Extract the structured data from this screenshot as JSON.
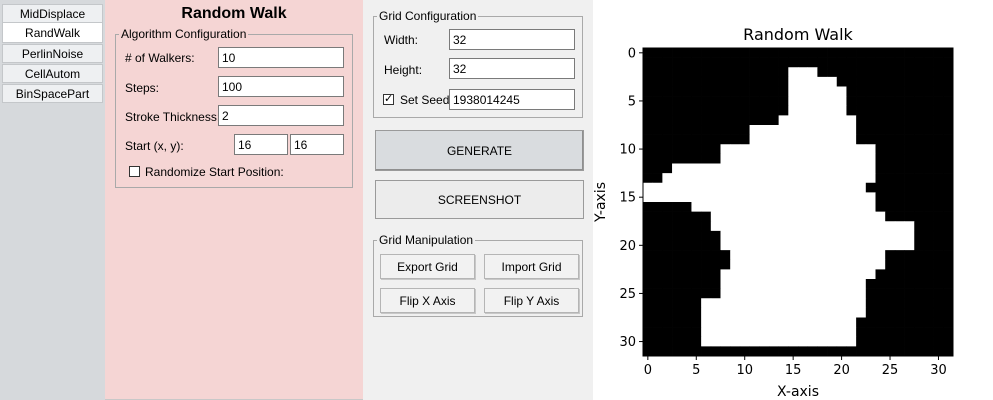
{
  "sidebar": {
    "tabs": [
      {
        "label": "MidDisplace",
        "active": false
      },
      {
        "label": "RandWalk",
        "active": true
      },
      {
        "label": "PerlinNoise",
        "active": false
      },
      {
        "label": "CellAutom",
        "active": false
      },
      {
        "label": "BinSpacePart",
        "active": false
      }
    ]
  },
  "algorithm": {
    "title": "Random Walk",
    "group_label": "Algorithm Configuration",
    "walkers_label": "# of Walkers:",
    "walkers_value": "10",
    "steps_label": "Steps:",
    "steps_value": "100",
    "stroke_label": "Stroke Thickness:",
    "stroke_value": "2",
    "start_label": "Start (x, y):",
    "start_x": "16",
    "start_y": "16",
    "randomize_label": "Randomize Start Position:",
    "randomize_checked": false
  },
  "grid_config": {
    "group_label": "Grid Configuration",
    "width_label": "Width:",
    "width_value": "32",
    "height_label": "Height:",
    "height_value": "32",
    "seed_label": "Set Seed",
    "seed_checked": true,
    "seed_value": "1938014245"
  },
  "actions": {
    "generate_label": "GENERATE",
    "screenshot_label": "SCREENSHOT"
  },
  "grid_manipulation": {
    "group_label": "Grid Manipulation",
    "export_label": "Export Grid",
    "import_label": "Import Grid",
    "flip_x_label": "Flip X Axis",
    "flip_y_label": "Flip Y Axis"
  },
  "chart_data": {
    "type": "heatmap",
    "title": "Random Walk",
    "xlabel": "X-axis",
    "ylabel": "Y-axis",
    "x_ticks": [
      0,
      5,
      10,
      15,
      20,
      25,
      30
    ],
    "y_ticks": [
      0,
      5,
      10,
      15,
      20,
      25,
      30
    ],
    "xlim": [
      -0.5,
      31.5
    ],
    "ylim": [
      31.5,
      -0.5
    ],
    "colormap": {
      "0": "#000000",
      "1": "#ffffff"
    },
    "rows": [
      "00000000000000000000000000000000",
      "00000000000000000000000000000000",
      "00000000000000011100000000000000",
      "00000000000000011111000000000000",
      "00000000000000011111100000000000",
      "00000000000000011111100000000000",
      "00000000000000011111100000000000",
      "00000000000000111111110000000000",
      "00000000000111111111110000000000",
      "00000000000111111111110000000000",
      "00000000111111111111111100000000",
      "00000000111111111111111100000000",
      "00011111111111111111111100000000",
      "00111111111111111111111100000000",
      "11111111111111111111111000000000",
      "11111111111111111111111100000000",
      "00000111111111111111111100000000",
      "00000001111111111111111110000000",
      "00000001111111111111111111110000",
      "00000000111111111111111111110000",
      "00000000111111111111111111110000",
      "00000000011111111111111110000000",
      "00000000011111111111111110000000",
      "00000000111111111111111100000000",
      "00000000111111111111111000000000",
      "00000000111111111111111000000000",
      "00000011111111111111111000000000",
      "00000011111111111111111000000000",
      "00000011111111111111110000000000",
      "00000011111111111111110000000000",
      "00000011111111111111110000000000",
      "00000000000000000000000000000000"
    ]
  }
}
